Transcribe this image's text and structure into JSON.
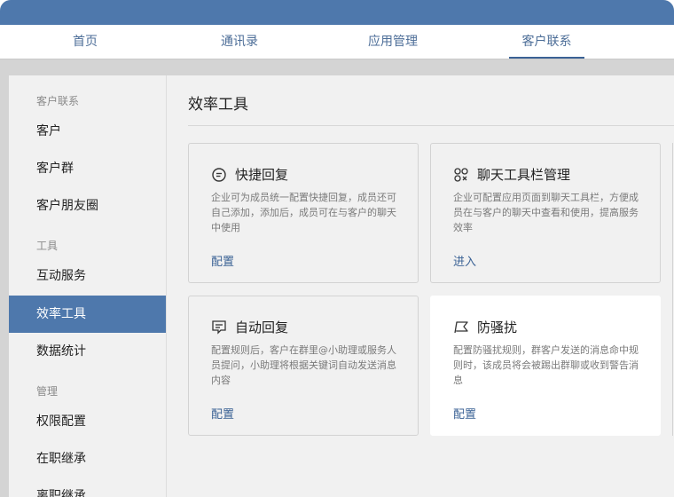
{
  "topnav": {
    "tabs": [
      {
        "label": "首页"
      },
      {
        "label": "通讯录"
      },
      {
        "label": "应用管理"
      },
      {
        "label": "客户联系"
      }
    ]
  },
  "sidebar": {
    "group1": "客户联系",
    "item_customer": "客户",
    "item_customer_group": "客户群",
    "item_moments": "客户朋友圈",
    "group2": "工具",
    "item_interaction": "互动服务",
    "item_efficiency": "效率工具",
    "item_stats": "数据统计",
    "group3": "管理",
    "item_permissions": "权限配置",
    "item_onjob": "在职继承",
    "item_resigned": "离职继承"
  },
  "main": {
    "title": "效率工具",
    "cards": [
      {
        "icon": "chat-bubble-icon",
        "title": "快捷回复",
        "desc": "企业可为成员统一配置快捷回复，成员还可自己添加，添加后，成员可在与客户的聊天中使用",
        "link": "配置"
      },
      {
        "icon": "toolbar-grid-icon",
        "title": "聊天工具栏管理",
        "desc": "企业可配置应用页面到聊天工具栏，方便成员在与客户的聊天中查看和使用，提高服务效率",
        "link": "进入"
      },
      {
        "icon": "auto-reply-icon",
        "title": "自动回复",
        "desc": "配置规则后，客户在群里@小助理或服务人员提问，小助理将根据关键词自动发送消息内容",
        "link": "配置"
      },
      {
        "icon": "flag-icon",
        "title": "防骚扰",
        "desc": "配置防骚扰规则，群客户发送的消息命中规则时，该成员将会被踢出群聊或收到警告消息",
        "link": "配置"
      }
    ]
  },
  "colors": {
    "accent": "#4e78ac",
    "link": "#3b6295",
    "background": "#f1f1f1"
  }
}
